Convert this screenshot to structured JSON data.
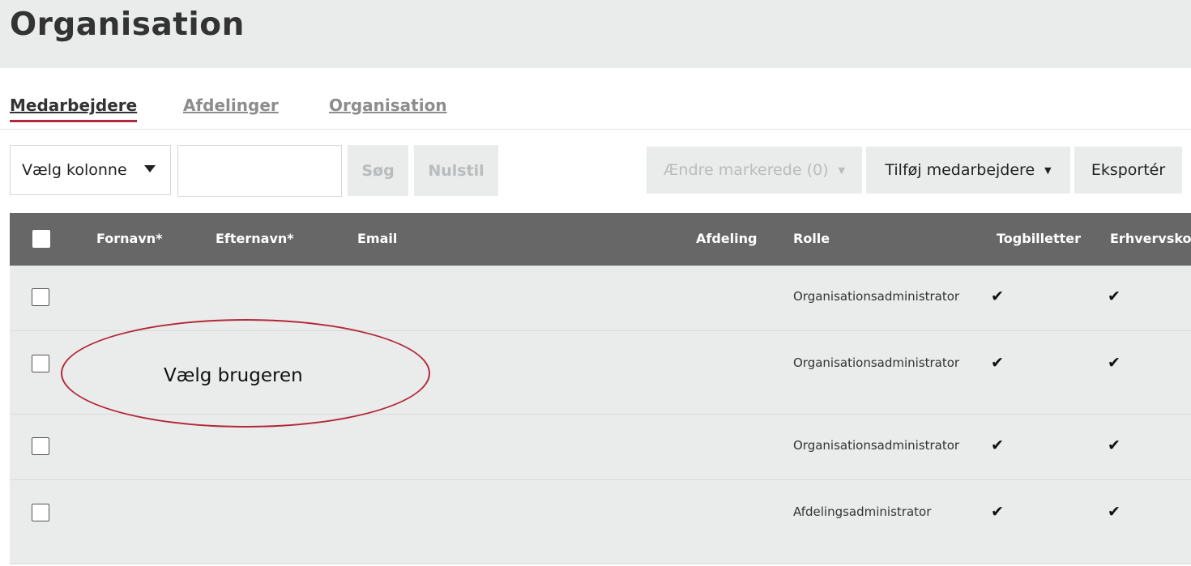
{
  "header": {
    "title": "Organisation"
  },
  "tabs": [
    {
      "label": "Medarbejdere",
      "active": true
    },
    {
      "label": "Afdelinger",
      "active": false
    },
    {
      "label": "Organisation",
      "active": false
    }
  ],
  "toolbar": {
    "column_select": "Vælg kolonne",
    "search_value": "",
    "search_label": "Søg",
    "reset_label": "Nulstil",
    "change_selected_label": "Ændre markerede (0)",
    "add_employees_label": "Tilføj medarbejdere",
    "export_label": "Eksportér"
  },
  "table": {
    "columns": [
      "Fornavn*",
      "Efternavn*",
      "Email",
      "Afdeling",
      "Rolle",
      "Togbilletter",
      "Erhvervskor"
    ],
    "rows": [
      {
        "role": "Organisationsadministrator",
        "togbilletter": "✔",
        "erhvervskort": "✔"
      },
      {
        "role": "Organisationsadministrator",
        "togbilletter": "✔",
        "erhvervskort": "✔"
      },
      {
        "role": "Organisationsadministrator",
        "togbilletter": "✔",
        "erhvervskort": "✔"
      },
      {
        "role": "Afdelingsadministrator",
        "togbilletter": "✔",
        "erhvervskort": "✔"
      }
    ]
  },
  "annotation": {
    "text": "Vælg brugeren"
  },
  "colors": {
    "accent": "#b4283c",
    "header_bg": "#e9ecea",
    "table_head": "#676767"
  },
  "icons": {
    "dropdown": "caret-down-icon",
    "check": "checkmark-icon"
  }
}
